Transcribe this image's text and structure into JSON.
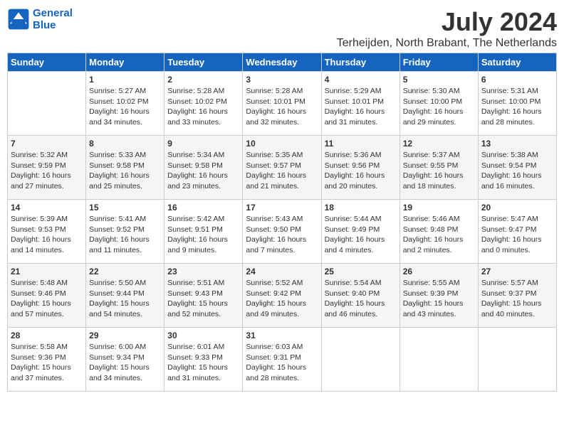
{
  "header": {
    "logo_line1": "General",
    "logo_line2": "Blue",
    "month": "July 2024",
    "location": "Terheijden, North Brabant, The Netherlands"
  },
  "weekdays": [
    "Sunday",
    "Monday",
    "Tuesday",
    "Wednesday",
    "Thursday",
    "Friday",
    "Saturday"
  ],
  "weeks": [
    [
      {
        "day": "",
        "content": ""
      },
      {
        "day": "1",
        "content": "Sunrise: 5:27 AM\nSunset: 10:02 PM\nDaylight: 16 hours\nand 34 minutes."
      },
      {
        "day": "2",
        "content": "Sunrise: 5:28 AM\nSunset: 10:02 PM\nDaylight: 16 hours\nand 33 minutes."
      },
      {
        "day": "3",
        "content": "Sunrise: 5:28 AM\nSunset: 10:01 PM\nDaylight: 16 hours\nand 32 minutes."
      },
      {
        "day": "4",
        "content": "Sunrise: 5:29 AM\nSunset: 10:01 PM\nDaylight: 16 hours\nand 31 minutes."
      },
      {
        "day": "5",
        "content": "Sunrise: 5:30 AM\nSunset: 10:00 PM\nDaylight: 16 hours\nand 29 minutes."
      },
      {
        "day": "6",
        "content": "Sunrise: 5:31 AM\nSunset: 10:00 PM\nDaylight: 16 hours\nand 28 minutes."
      }
    ],
    [
      {
        "day": "7",
        "content": "Sunrise: 5:32 AM\nSunset: 9:59 PM\nDaylight: 16 hours\nand 27 minutes."
      },
      {
        "day": "8",
        "content": "Sunrise: 5:33 AM\nSunset: 9:58 PM\nDaylight: 16 hours\nand 25 minutes."
      },
      {
        "day": "9",
        "content": "Sunrise: 5:34 AM\nSunset: 9:58 PM\nDaylight: 16 hours\nand 23 minutes."
      },
      {
        "day": "10",
        "content": "Sunrise: 5:35 AM\nSunset: 9:57 PM\nDaylight: 16 hours\nand 21 minutes."
      },
      {
        "day": "11",
        "content": "Sunrise: 5:36 AM\nSunset: 9:56 PM\nDaylight: 16 hours\nand 20 minutes."
      },
      {
        "day": "12",
        "content": "Sunrise: 5:37 AM\nSunset: 9:55 PM\nDaylight: 16 hours\nand 18 minutes."
      },
      {
        "day": "13",
        "content": "Sunrise: 5:38 AM\nSunset: 9:54 PM\nDaylight: 16 hours\nand 16 minutes."
      }
    ],
    [
      {
        "day": "14",
        "content": "Sunrise: 5:39 AM\nSunset: 9:53 PM\nDaylight: 16 hours\nand 14 minutes."
      },
      {
        "day": "15",
        "content": "Sunrise: 5:41 AM\nSunset: 9:52 PM\nDaylight: 16 hours\nand 11 minutes."
      },
      {
        "day": "16",
        "content": "Sunrise: 5:42 AM\nSunset: 9:51 PM\nDaylight: 16 hours\nand 9 minutes."
      },
      {
        "day": "17",
        "content": "Sunrise: 5:43 AM\nSunset: 9:50 PM\nDaylight: 16 hours\nand 7 minutes."
      },
      {
        "day": "18",
        "content": "Sunrise: 5:44 AM\nSunset: 9:49 PM\nDaylight: 16 hours\nand 4 minutes."
      },
      {
        "day": "19",
        "content": "Sunrise: 5:46 AM\nSunset: 9:48 PM\nDaylight: 16 hours\nand 2 minutes."
      },
      {
        "day": "20",
        "content": "Sunrise: 5:47 AM\nSunset: 9:47 PM\nDaylight: 16 hours\nand 0 minutes."
      }
    ],
    [
      {
        "day": "21",
        "content": "Sunrise: 5:48 AM\nSunset: 9:46 PM\nDaylight: 15 hours\nand 57 minutes."
      },
      {
        "day": "22",
        "content": "Sunrise: 5:50 AM\nSunset: 9:44 PM\nDaylight: 15 hours\nand 54 minutes."
      },
      {
        "day": "23",
        "content": "Sunrise: 5:51 AM\nSunset: 9:43 PM\nDaylight: 15 hours\nand 52 minutes."
      },
      {
        "day": "24",
        "content": "Sunrise: 5:52 AM\nSunset: 9:42 PM\nDaylight: 15 hours\nand 49 minutes."
      },
      {
        "day": "25",
        "content": "Sunrise: 5:54 AM\nSunset: 9:40 PM\nDaylight: 15 hours\nand 46 minutes."
      },
      {
        "day": "26",
        "content": "Sunrise: 5:55 AM\nSunset: 9:39 PM\nDaylight: 15 hours\nand 43 minutes."
      },
      {
        "day": "27",
        "content": "Sunrise: 5:57 AM\nSunset: 9:37 PM\nDaylight: 15 hours\nand 40 minutes."
      }
    ],
    [
      {
        "day": "28",
        "content": "Sunrise: 5:58 AM\nSunset: 9:36 PM\nDaylight: 15 hours\nand 37 minutes."
      },
      {
        "day": "29",
        "content": "Sunrise: 6:00 AM\nSunset: 9:34 PM\nDaylight: 15 hours\nand 34 minutes."
      },
      {
        "day": "30",
        "content": "Sunrise: 6:01 AM\nSunset: 9:33 PM\nDaylight: 15 hours\nand 31 minutes."
      },
      {
        "day": "31",
        "content": "Sunrise: 6:03 AM\nSunset: 9:31 PM\nDaylight: 15 hours\nand 28 minutes."
      },
      {
        "day": "",
        "content": ""
      },
      {
        "day": "",
        "content": ""
      },
      {
        "day": "",
        "content": ""
      }
    ]
  ]
}
